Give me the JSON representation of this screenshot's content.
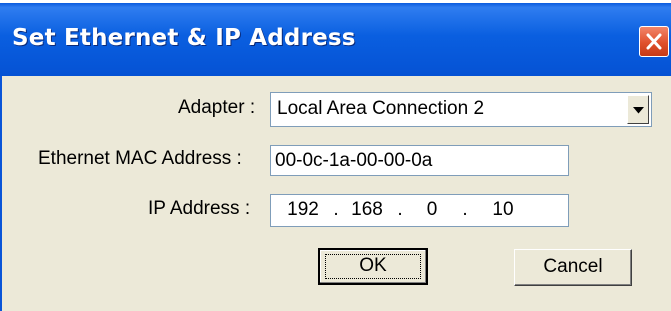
{
  "dialog": {
    "title": "Set Ethernet & IP Address",
    "close_icon": "close-icon"
  },
  "form": {
    "adapter_label": "Adapter :",
    "adapter_value": "Local Area Connection 2",
    "mac_label": "Ethernet MAC Address :",
    "mac_value": "00-0c-1a-00-00-0a",
    "ip_label": "IP Address :",
    "ip_octets": [
      "192",
      "168",
      "0",
      "10"
    ],
    "ip_separator": "."
  },
  "buttons": {
    "ok_label": "OK",
    "cancel_label": "Cancel"
  },
  "colors": {
    "titlebar": "#0a5fe0",
    "client_bg": "#ece9d8",
    "close_button": "#e0502c"
  }
}
